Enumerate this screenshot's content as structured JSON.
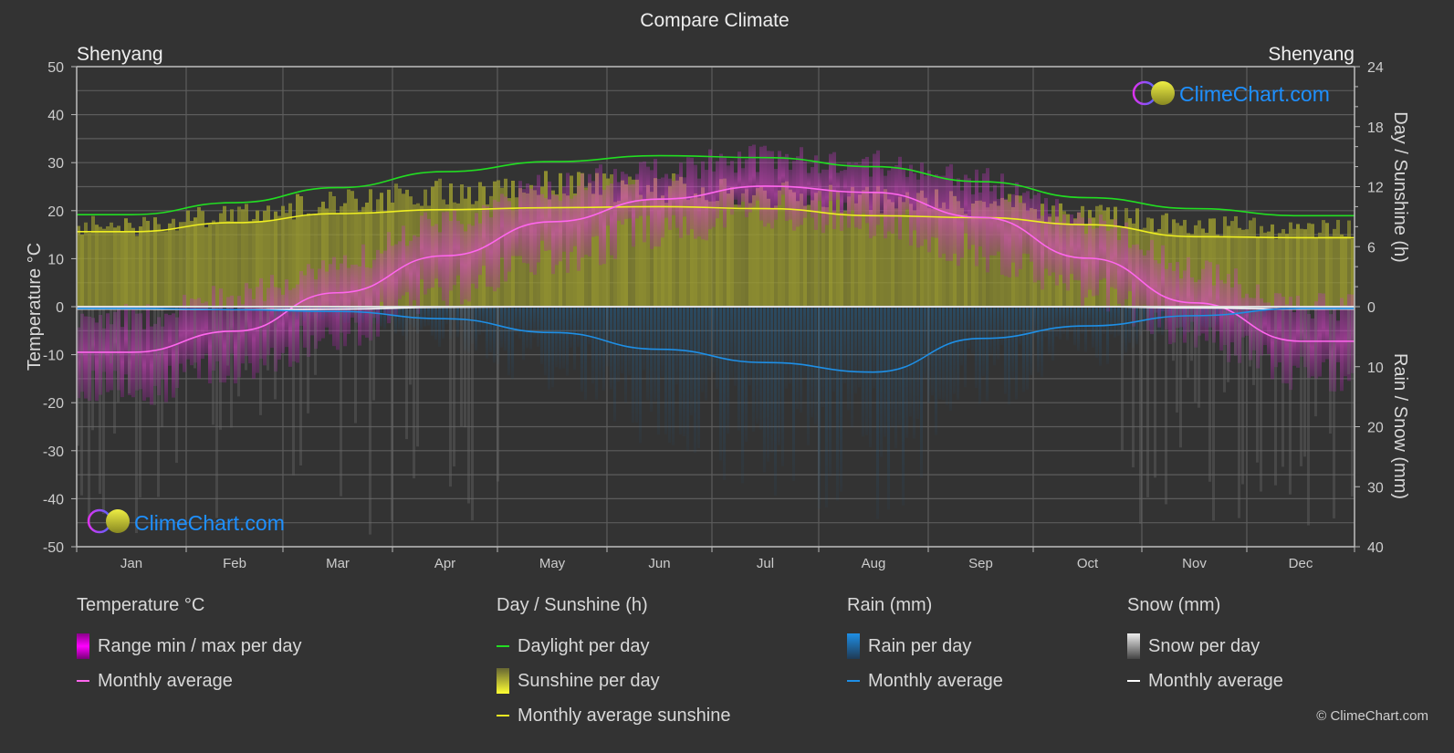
{
  "title": "Compare Climate",
  "location_left": "Shenyang",
  "location_right": "Shenyang",
  "watermark": "ClimeChart.com",
  "copyright": "© ClimeChart.com",
  "colors": {
    "background": "#333333",
    "grid": "#5a5a5a",
    "temp_avg": "#ff66ee",
    "temp_range": "#cc33cc",
    "daylight": "#22dd22",
    "sunshine_fill": "#9a9a30",
    "sunshine_avg": "#eeee22",
    "rain": "#1e8fe6",
    "rain_fill": "#1f5a88",
    "snow": "#ffffff",
    "snow_fill": "#707070",
    "brand": "#1e90ff"
  },
  "chart_data": {
    "type": "line",
    "title": "Compare Climate",
    "categories": [
      "Jan",
      "Feb",
      "Mar",
      "Apr",
      "May",
      "Jun",
      "Jul",
      "Aug",
      "Sep",
      "Oct",
      "Nov",
      "Dec"
    ],
    "left_axis": {
      "label": "Temperature °C",
      "range": [
        -50,
        50
      ],
      "ticks": [
        50,
        40,
        30,
        20,
        10,
        0,
        -10,
        -20,
        -30,
        -40,
        -50
      ]
    },
    "right_axis_top": {
      "label": "Day / Sunshine (h)",
      "range": [
        0,
        24
      ],
      "ticks": [
        24,
        18,
        12,
        6,
        0
      ]
    },
    "right_axis_bottom": {
      "label": "Rain / Snow (mm)",
      "range": [
        0,
        40
      ],
      "ticks": [
        0,
        10,
        20,
        30,
        40
      ]
    },
    "grid": true,
    "series": [
      {
        "name": "Temperature monthly average",
        "axis": "left",
        "unit": "°C",
        "values": [
          -9.5,
          -5.1,
          2.9,
          10.6,
          17.7,
          22.4,
          25.1,
          23.8,
          18.6,
          10.1,
          0.8,
          -7.2
        ]
      },
      {
        "name": "Temperature range max per day",
        "axis": "left",
        "unit": "°C",
        "values": [
          -2,
          2,
          9,
          18,
          25,
          29,
          31,
          30,
          26,
          18,
          8,
          0
        ]
      },
      {
        "name": "Temperature range min per day",
        "axis": "left",
        "unit": "°C",
        "values": [
          -17,
          -13,
          -5,
          3,
          10,
          16,
          20,
          18,
          11,
          3,
          -6,
          -14
        ]
      },
      {
        "name": "Daylight per day",
        "axis": "right_top",
        "unit": "h",
        "values": [
          9.2,
          10.4,
          11.9,
          13.5,
          14.5,
          15.1,
          14.9,
          14.0,
          12.5,
          10.9,
          9.8,
          9.1
        ]
      },
      {
        "name": "Sunshine per day",
        "axis": "right_top",
        "unit": "h",
        "values": [
          8.3,
          9.4,
          10.8,
          11.7,
          12.4,
          12.2,
          11.5,
          11.0,
          10.5,
          9.4,
          8.4,
          7.9
        ]
      },
      {
        "name": "Monthly average sunshine",
        "axis": "right_top",
        "unit": "h",
        "values": [
          7.5,
          8.4,
          9.3,
          9.7,
          9.9,
          10.0,
          9.8,
          9.1,
          8.9,
          8.2,
          7.0,
          6.9
        ]
      },
      {
        "name": "Rain monthly average",
        "axis": "right_bottom",
        "unit": "mm",
        "values": [
          0.3,
          0.5,
          0.8,
          2.0,
          4.3,
          7.1,
          9.3,
          10.9,
          5.3,
          3.2,
          1.5,
          0.3
        ]
      },
      {
        "name": "Snow monthly average",
        "axis": "right_bottom",
        "unit": "mm",
        "values": [
          0.4,
          0.5,
          0.4,
          0.1,
          0,
          0,
          0,
          0,
          0,
          0,
          0.2,
          0.4
        ]
      }
    ]
  },
  "legend": {
    "groups": [
      {
        "title": "Temperature °C",
        "items": [
          {
            "label": "Range min / max per day",
            "kind": "box",
            "color": "#e020e0"
          },
          {
            "label": "Monthly average",
            "kind": "line",
            "color": "#ff66ee"
          }
        ]
      },
      {
        "title": "Day / Sunshine (h)",
        "items": [
          {
            "label": "Daylight per day",
            "kind": "line",
            "color": "#22dd22"
          },
          {
            "label": "Sunshine per day",
            "kind": "box",
            "color": "#eeee33"
          },
          {
            "label": "Monthly average sunshine",
            "kind": "line",
            "color": "#eeee22"
          }
        ]
      },
      {
        "title": "Rain (mm)",
        "items": [
          {
            "label": "Rain per day",
            "kind": "box",
            "color": "#1e8fe6"
          },
          {
            "label": "Monthly average",
            "kind": "line",
            "color": "#1e8fe6"
          }
        ]
      },
      {
        "title": "Snow (mm)",
        "items": [
          {
            "label": "Snow per day",
            "kind": "box",
            "color": "#dddddd"
          },
          {
            "label": "Monthly average",
            "kind": "line",
            "color": "#ffffff"
          }
        ]
      }
    ]
  }
}
